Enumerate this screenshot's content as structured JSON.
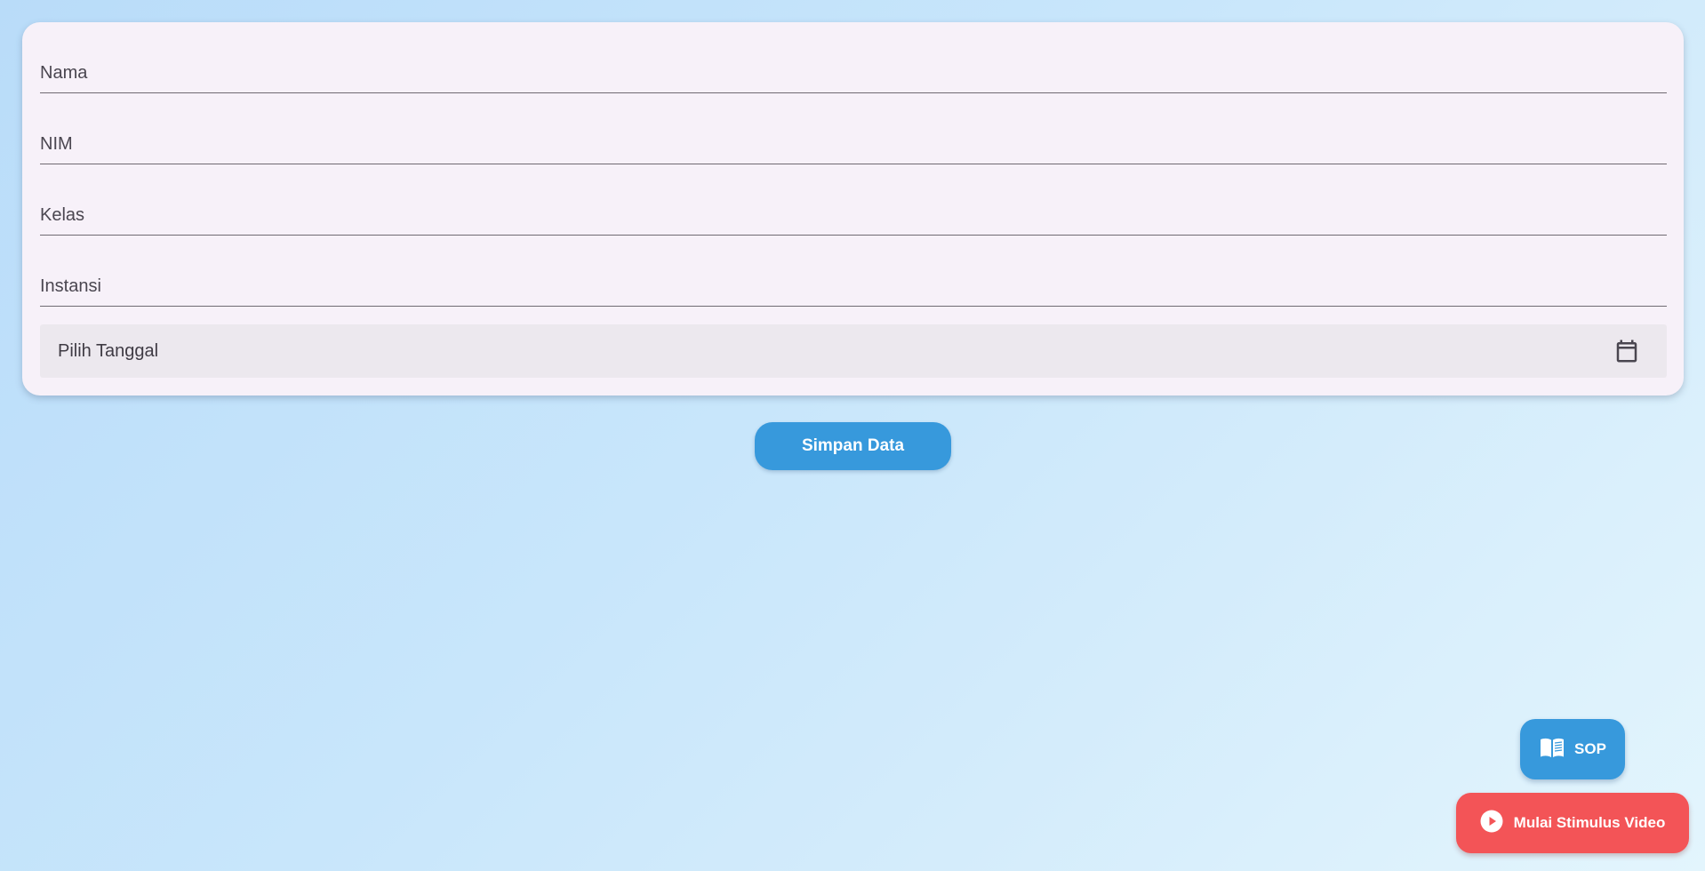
{
  "form": {
    "nama": {
      "placeholder": "Nama",
      "value": ""
    },
    "nim": {
      "placeholder": "NIM",
      "value": ""
    },
    "kelas": {
      "placeholder": "Kelas",
      "value": ""
    },
    "instansi": {
      "placeholder": "Instansi",
      "value": ""
    },
    "tanggal": {
      "label": "Pilih Tanggal",
      "icon": "calendar-icon"
    }
  },
  "actions": {
    "save_label": "Simpan Data"
  },
  "fab": {
    "sop_label": "SOP",
    "sop_icon": "book-icon",
    "video_label": "Mulai Stimulus Video",
    "video_icon": "play-circle-icon"
  },
  "colors": {
    "primary": "#3799dc",
    "danger": "#f35457",
    "card": "#f7f1f9"
  }
}
